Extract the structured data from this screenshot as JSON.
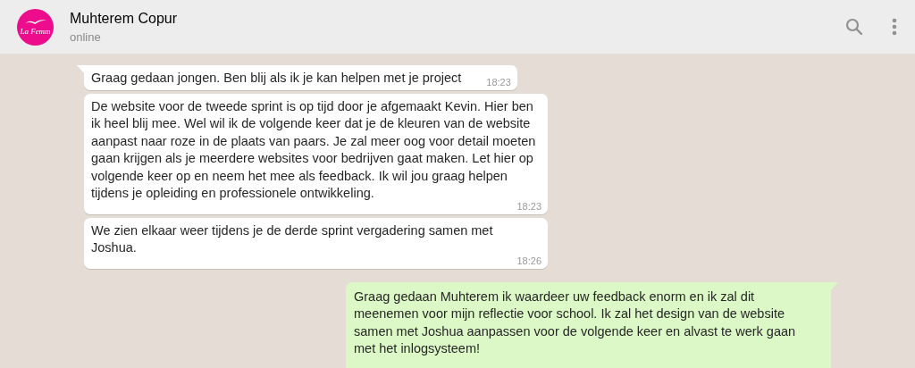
{
  "header": {
    "avatar_text": "La Femm",
    "name": "Muhterem Copur",
    "status": "online"
  },
  "messages": [
    {
      "kind": "incoming",
      "tail": true,
      "text": "Graag gedaan jongen. Ben blij als ik je kan helpen met je project",
      "time": "18:23"
    },
    {
      "kind": "incoming",
      "tail": false,
      "text": "De website voor de tweede sprint is op tijd door je afgemaakt Kevin. Hier ben ik heel blij mee. Wel wil ik de volgende keer dat je de kleuren van de website aanpast naar roze in de plaats van paars. Je zal meer oog voor detail moeten gaan krijgen als je meerdere websites voor bedrijven gaat maken. Let hier op volgende keer op en neem het mee als feedback. Ik wil jou graag helpen tijdens je opleiding en professionele ontwikkeling.",
      "time": "18:23"
    },
    {
      "kind": "incoming",
      "tail": false,
      "text": "We zien elkaar weer tijdens je de derde sprint vergadering samen met Joshua.",
      "time": "18:26"
    },
    {
      "kind": "outgoing",
      "tail": true,
      "text": "Graag gedaan Muhterem ik waardeer uw feedback enorm en ik zal dit meenemen voor mijn reflectie voor school. Ik zal het design van de website samen met Joshua aanpassen voor de volgende keer en alvast te werk gaan met het inlogsysteem!"
    }
  ]
}
